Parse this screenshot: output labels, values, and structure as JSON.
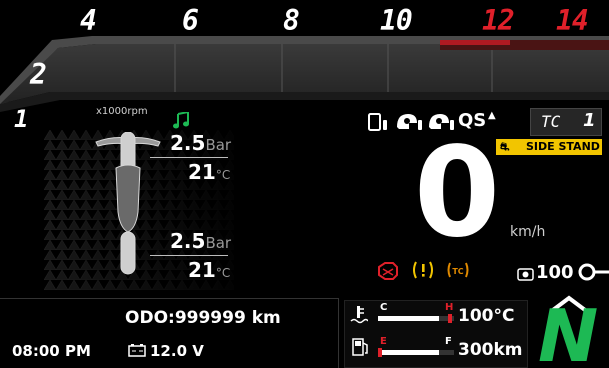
{
  "tach": {
    "scale_label": "x1000rpm",
    "marks": [
      {
        "label": "1",
        "color": "#ffffff"
      },
      {
        "label": "2",
        "color": "#ffffff"
      },
      {
        "label": "4",
        "color": "#ffffff"
      },
      {
        "label": "6",
        "color": "#ffffff"
      },
      {
        "label": "8",
        "color": "#ffffff"
      },
      {
        "label": "10",
        "color": "#ffffff"
      },
      {
        "label": "12",
        "color": "#e0202a"
      },
      {
        "label": "14",
        "color": "#e0202a"
      }
    ]
  },
  "tires": {
    "front_pressure": "2.5",
    "front_pressure_unit": "Bar",
    "front_temp": "21",
    "front_temp_unit": "°C",
    "rear_pressure": "2.5",
    "rear_pressure_unit": "Bar",
    "rear_temp": "21",
    "rear_temp_unit": "°C"
  },
  "status": {
    "qs_label": "QS",
    "tc_label": "TC",
    "tc_value": "1",
    "side_stand_label": "SIDE STAND"
  },
  "speed": {
    "value": "0",
    "unit": "km/h"
  },
  "cruise": {
    "value": "100"
  },
  "odo": {
    "label": "ODO:999999 km"
  },
  "clock": {
    "time": "08:00 PM"
  },
  "battery": {
    "voltage": "12.0 V"
  },
  "coolant": {
    "low_mark": "C",
    "high_mark": "H",
    "value": "100°C",
    "fill_fraction": 0.8
  },
  "fuel": {
    "empty_mark": "E",
    "full_mark": "F",
    "range": "300km",
    "fill_fraction": 0.8
  },
  "gear": {
    "value": "N"
  },
  "colors": {
    "accent_green": "#1db954",
    "warning_red": "#e0202a",
    "warning_yellow": "#f2c500",
    "tc_amber": "#e08a00",
    "stand_badge": "#f2c500"
  }
}
